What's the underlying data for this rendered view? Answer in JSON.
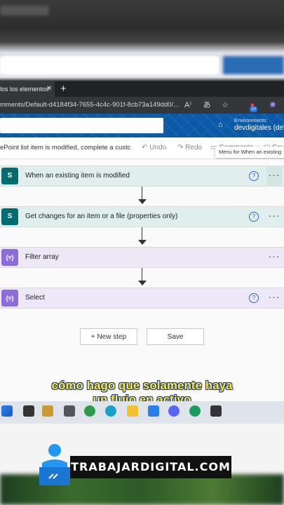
{
  "browser": {
    "tab_title": "los los elementos",
    "tab_close": "✕",
    "new_tab": "+",
    "url": "mments/Default-d4184f34-7655-4c4c-901f-8cb73a149dd0/...",
    "ext_badge": "10"
  },
  "header": {
    "env_label": "Environments",
    "env_name": "devdigitales (defa"
  },
  "command_bar": {
    "flow_title": "ePoint list item is modified, complete a custc",
    "undo": "Undo",
    "redo": "Redo",
    "comments": "Comments",
    "save": "Sav",
    "tooltip": "Menu for When an existing"
  },
  "steps": [
    {
      "title": "When an existing item is modified",
      "icon": "S",
      "kind": "sharepoint",
      "help": "?",
      "more": "···"
    },
    {
      "title": "Get changes for an item or a file (properties only)",
      "icon": "S",
      "kind": "sharepoint",
      "help": "?",
      "more": "···"
    },
    {
      "title": "Filter array",
      "icon": "{▿}",
      "kind": "data-operation",
      "more": "···"
    },
    {
      "title": "Select",
      "icon": "{▿}",
      "kind": "data-operation",
      "help": "?",
      "more": "···"
    }
  ],
  "actions": {
    "new_step": "+ New step",
    "save": "Save"
  },
  "caption": {
    "line1": "cómo hago que solamente haya",
    "line2": "un flujo en activo"
  },
  "banner": "TRABAJARDIGITAL.COM",
  "colors": {
    "sharepoint": "#036c70",
    "data_operation": "#8c6cd8",
    "header_blue": "#0b5aa8",
    "caption_yellow": "#ffeb3b"
  }
}
